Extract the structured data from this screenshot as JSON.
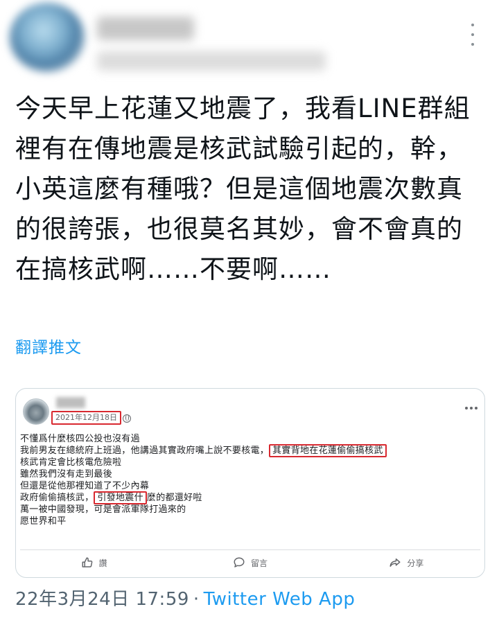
{
  "author": {
    "name": "",
    "handle": ""
  },
  "tweet": {
    "text": "今天早上花蓮又地震了，我看LINE群組裡有在傳地震是核武試驗引起的，幹，小英這麼有種哦？但是這個地震次數真的很誇張，也很莫名其妙，會不會真的在搞核武啊……不要啊……",
    "translate_label": "翻譯推文",
    "timestamp": "22年3月24日 17:59",
    "separator": "·",
    "source": "Twitter Web App"
  },
  "embedded_post": {
    "date": "2021年12月18日",
    "lines": [
      {
        "pre": "不懂爲什麼核四公投也沒有過",
        "highlight": "",
        "post": ""
      },
      {
        "pre": "我前男友在總統府上班過，他講過其實政府嘴上說不要核電，",
        "highlight": "其實背地在花蓮偷偷搞核武",
        "post": ""
      },
      {
        "pre": "核武肯定會比核電危險啦",
        "highlight": "",
        "post": ""
      },
      {
        "pre": "雖然我們沒有走到最後",
        "highlight": "",
        "post": ""
      },
      {
        "pre": "但還是從他那裡知道了不少內幕",
        "highlight": "",
        "post": ""
      },
      {
        "pre": "政府偷偷搞核武，",
        "highlight": "引發地震什",
        "post": "麼的都還好啦"
      },
      {
        "pre": "萬一被中國發現，可是會派軍隊打過來的",
        "highlight": "",
        "post": ""
      },
      {
        "pre": "愿世界和平",
        "highlight": "",
        "post": ""
      }
    ],
    "actions": {
      "like": "讚",
      "comment": "留言",
      "share": "分享"
    }
  },
  "colors": {
    "text": "#0f1419",
    "link": "#1d9bf0",
    "meta": "#536471",
    "highlight_box": "#d8282f",
    "border": "#cfd9de"
  }
}
